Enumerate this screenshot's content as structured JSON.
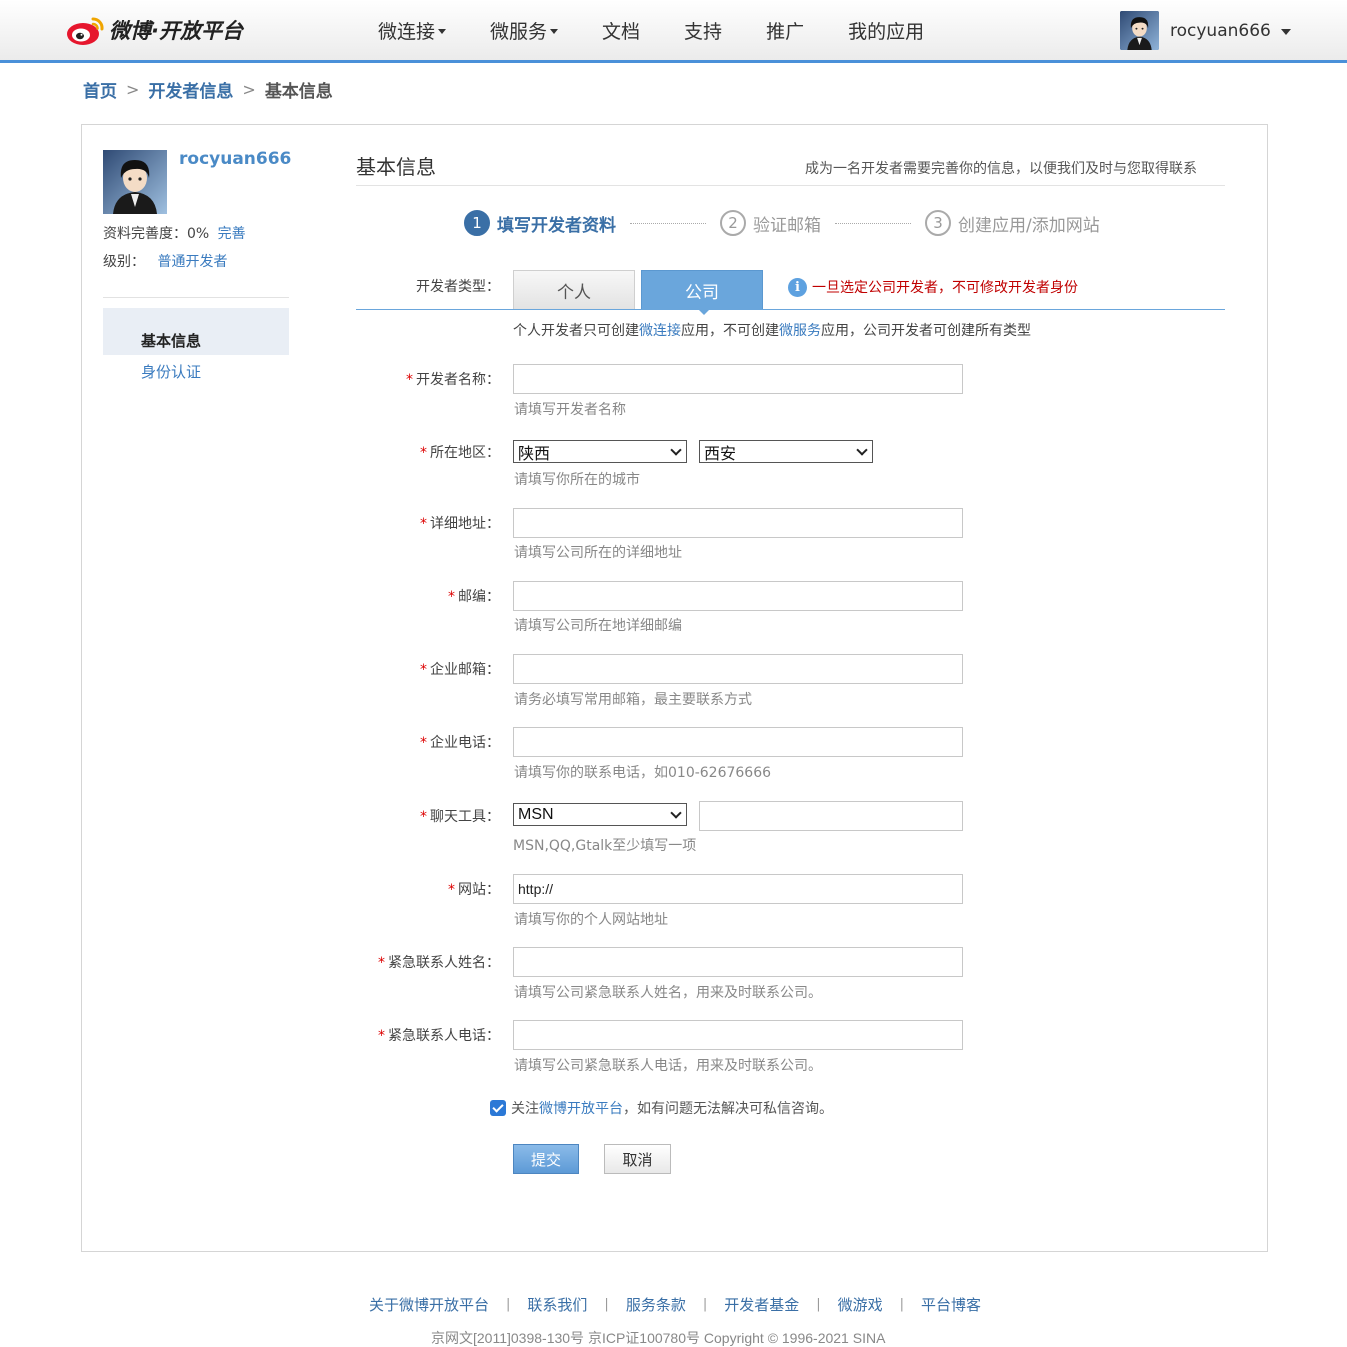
{
  "header": {
    "logo_text": "微博·开放平台",
    "nav": [
      {
        "label": "微连接",
        "has_dropdown": true
      },
      {
        "label": "微服务",
        "has_dropdown": true
      },
      {
        "label": "文档",
        "has_dropdown": false
      },
      {
        "label": "支持",
        "has_dropdown": false
      },
      {
        "label": "推广",
        "has_dropdown": false
      },
      {
        "label": "我的应用",
        "has_dropdown": false
      }
    ],
    "username": "rocyuan666"
  },
  "breadcrumb": {
    "home": "首页",
    "parent": "开发者信息",
    "current": "基本信息",
    "separator": ">"
  },
  "sidebar": {
    "username": "rocyuan666",
    "completeness_label": "资料完善度：",
    "completeness_value": "0%",
    "complete_link": "完善",
    "level_label": "级别：",
    "level_value": "普通开发者",
    "menu": [
      {
        "label": "基本信息",
        "active": true
      },
      {
        "label": "身份认证",
        "active": false
      }
    ]
  },
  "content": {
    "title": "基本信息",
    "note": "成为一名开发者需要完善你的信息，以便我们及时与您取得联系",
    "steps": [
      {
        "num": "1",
        "label": "填写开发者资料",
        "active": true
      },
      {
        "num": "2",
        "label": "验证邮箱",
        "active": false
      },
      {
        "num": "3",
        "label": "创建应用/添加网站",
        "active": false
      }
    ],
    "dev_type_label": "开发者类型：",
    "tabs": [
      {
        "label": "个人",
        "active": false
      },
      {
        "label": "公司",
        "active": true
      }
    ],
    "warning": "一旦选定公司开发者，不可修改开发者身份",
    "type_note_pre": "个人开发者只可创建",
    "type_note_link1": "微连接",
    "type_note_mid": "应用，不可创建",
    "type_note_link2": "微服务",
    "type_note_post": "应用，公司开发者可创建所有类型"
  },
  "form": {
    "required_mark": "*",
    "name": {
      "label": "开发者名称：",
      "value": "",
      "hint": "请填写开发者名称"
    },
    "region": {
      "label": "所在地区：",
      "province": "陕西",
      "city": "西安",
      "hint": "请填写你所在的城市"
    },
    "address": {
      "label": "详细地址：",
      "value": "",
      "hint": "请填写公司所在的详细地址"
    },
    "postcode": {
      "label": "邮编：",
      "value": "",
      "hint": "请填写公司所在地详细邮编"
    },
    "email": {
      "label": "企业邮箱：",
      "value": "",
      "hint": "请务必填写常用邮箱，最主要联系方式"
    },
    "phone": {
      "label": "企业电话：",
      "value": "",
      "hint": "请填写你的联系电话，如010-62676666"
    },
    "im": {
      "label": "聊天工具：",
      "selected": "MSN",
      "value": "",
      "hint": "MSN,QQ,Gtalk至少填写一项"
    },
    "website": {
      "label": "网站：",
      "value": "http://",
      "hint": "请填写你的个人网站地址"
    },
    "emergency_name": {
      "label": "紧急联系人姓名：",
      "value": "",
      "hint": "请填写公司紧急联系人姓名，用来及时联系公司。"
    },
    "emergency_phone": {
      "label": "紧急联系人电话：",
      "value": "",
      "hint": "请填写公司紧急联系人电话，用来及时联系公司。"
    },
    "follow_pre": "关注",
    "follow_link": "微博开放平台",
    "follow_post": "，如有问题无法解决可私信咨询。",
    "follow_checked": true,
    "submit": "提交",
    "cancel": "取消"
  },
  "footer": {
    "links": [
      "关于微博开放平台",
      "联系我们",
      "服务条款",
      "开发者基金",
      "微游戏",
      "平台博客"
    ],
    "separator": "|",
    "copyright": "京网文[2011]0398-130号 京ICP证100780号 Copyright © 1996-2021 SINA"
  },
  "colors": {
    "accent": "#4a90d9",
    "link": "#3a7bbf",
    "warning": "#c00000",
    "tab_active": "#6aa6dc"
  },
  "icons": [
    "weibo-logo-icon",
    "info-icon",
    "checkbox-checked-icon",
    "chevron-down-icon"
  ]
}
